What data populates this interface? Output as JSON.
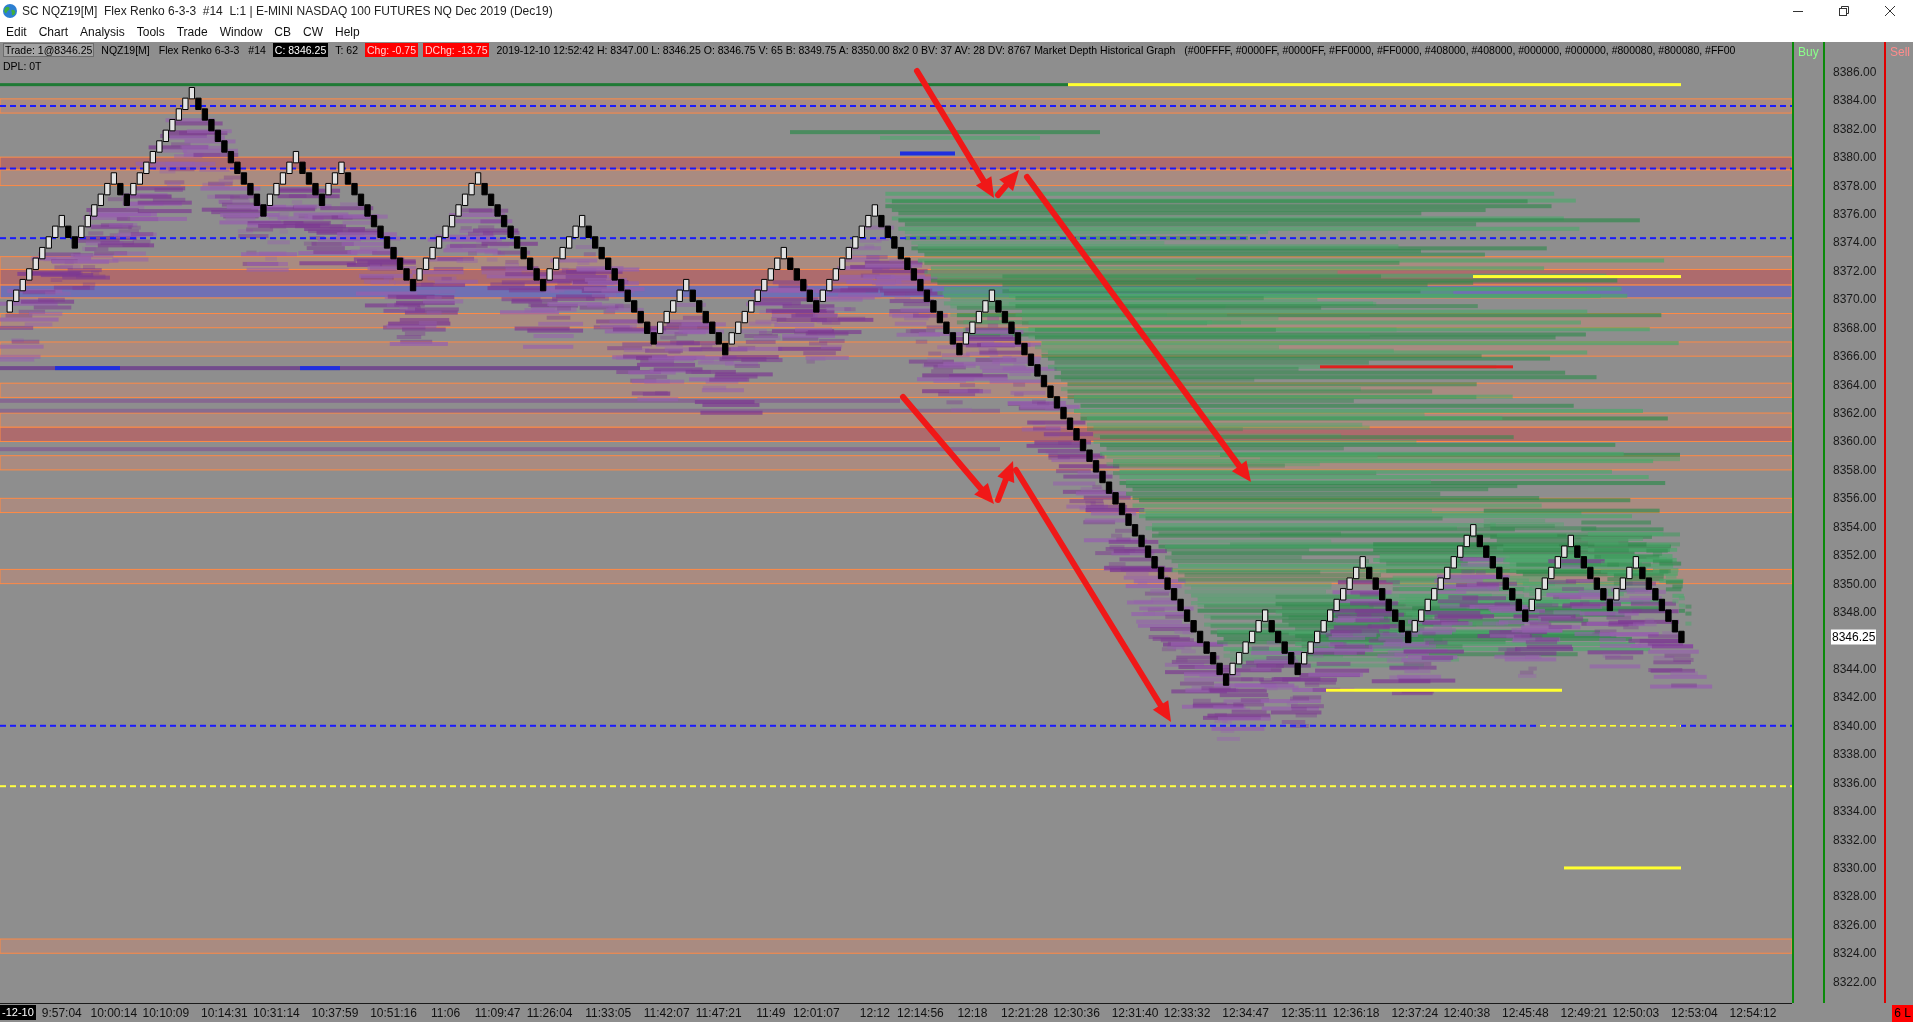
{
  "window": {
    "title": "SC NQZ19[M]  Flex Renko 6-3-3  #14  L:1 | E-MINI NASDAQ 100 FUTURES NQ Dec 2019 (Dec19)"
  },
  "menu": [
    "Edit",
    "Chart",
    "Analysis",
    "Tools",
    "Trade",
    "Window",
    "CB",
    "CW",
    "Help"
  ],
  "info_bar": {
    "items": [
      {
        "text": "Trade: 1@8346.25",
        "kind": "boxed"
      },
      {
        "text": "NQZ19[M]",
        "kind": "plain"
      },
      {
        "text": "Flex Renko 6-3-3",
        "kind": "plain"
      },
      {
        "text": "#14",
        "kind": "plain"
      },
      {
        "text": "C: 8346.25",
        "kind": "inverse"
      },
      {
        "text": "T: 62",
        "kind": "plain"
      },
      {
        "text": "Chg: -0.75",
        "kind": "alert"
      },
      {
        "text": "DChg: -13.75",
        "kind": "alert"
      },
      {
        "text": "2019-12-10 12:52:42 H: 8347.00 L: 8346.25 O: 8346.75 V: 65 B: 8349.75 A: 8350.00 8x2 0 BV: 37 AV: 28 DV: 8767 Market Depth Historical Graph",
        "kind": "plain"
      },
      {
        "text": "(#00FFFF, #0000FF, #0000FF, #FF0000, #FF0000, #408000, #408000, #000000, #000000, #800080, #800080, #FF00",
        "kind": "plain"
      }
    ],
    "second_line": "DPL: 0T"
  },
  "trade_columns": {
    "buy_label": "Buy",
    "sell_label": "Sell",
    "order_badge": "6 L"
  },
  "price_scale": {
    "last_price_label": "8346.25"
  },
  "time_axis": {
    "date_label": "-12-10"
  },
  "chart_data": {
    "type": "scatter",
    "categories": [
      null,
      null,
      null,
      null,
      null,
      null,
      null,
      null,
      "9:57:04",
      null,
      null,
      null,
      null,
      null,
      null,
      null,
      "10:00:14",
      null,
      null,
      null,
      null,
      null,
      null,
      null,
      "10:10:09",
      null,
      null,
      null,
      null,
      null,
      null,
      null,
      null,
      "10:14:31",
      null,
      null,
      null,
      null,
      null,
      null,
      null,
      "10:31:14",
      null,
      null,
      null,
      null,
      null,
      null,
      null,
      null,
      "10:37:59",
      null,
      null,
      null,
      null,
      null,
      null,
      null,
      null,
      "10:51:16",
      null,
      null,
      null,
      null,
      null,
      null,
      null,
      "11:06",
      null,
      null,
      null,
      null,
      null,
      null,
      null,
      "11:09:47",
      null,
      null,
      null,
      null,
      null,
      null,
      null,
      "11:26:04",
      null,
      null,
      null,
      null,
      null,
      null,
      null,
      null,
      "11:33:05",
      null,
      null,
      null,
      null,
      null,
      null,
      null,
      null,
      "11:42:07",
      null,
      null,
      null,
      null,
      null,
      null,
      null,
      "11:47:21",
      null,
      null,
      null,
      null,
      null,
      null,
      null,
      "11:49",
      null,
      null,
      null,
      null,
      null,
      null,
      "12:01:07",
      null,
      null,
      null,
      null,
      null,
      null,
      null,
      null,
      "12:12",
      null,
      null,
      null,
      null,
      null,
      null,
      "12:14:56",
      null,
      null,
      null,
      null,
      null,
      null,
      null,
      "12:18",
      null,
      null,
      null,
      null,
      null,
      null,
      null,
      "12:21:28",
      null,
      null,
      null,
      null,
      null,
      null,
      null,
      "12:30:36",
      null,
      null,
      null,
      null,
      null,
      null,
      null,
      null,
      "12:31:40",
      null,
      null,
      null,
      null,
      null,
      null,
      null,
      "12:33:32",
      null,
      null,
      null,
      null,
      null,
      null,
      null,
      null,
      "12:34:47",
      null,
      null,
      null,
      null,
      null,
      null,
      null,
      null,
      "12:35:11",
      null,
      null,
      null,
      null,
      null,
      null,
      null,
      "12:36:18",
      null,
      null,
      null,
      null,
      null,
      null,
      null,
      null,
      "12:37:24",
      null,
      null,
      null,
      null,
      null,
      null,
      null,
      "12:40:38",
      null,
      null,
      null,
      null,
      null,
      null,
      null,
      null,
      "12:45:48",
      null,
      null,
      null,
      null,
      null,
      null,
      null,
      null,
      "12:49:21",
      null,
      null,
      null,
      null,
      null,
      null,
      null,
      "12:50:03",
      null,
      null,
      null,
      null,
      null,
      null,
      null,
      null,
      "12:53:04",
      null,
      null,
      null,
      null,
      null,
      null,
      null,
      null,
      "12:54:12",
      null,
      null,
      null,
      null,
      null
    ],
    "ylim": [
      8320.5,
      8388.1
    ],
    "yticks": [
      {
        "value": 8386,
        "label": "8386.00"
      },
      {
        "value": 8384,
        "label": "8384.00"
      },
      {
        "value": 8382,
        "label": "8382.00"
      },
      {
        "value": 8380,
        "label": "8380.00"
      },
      {
        "value": 8378,
        "label": "8378.00"
      },
      {
        "value": 8376,
        "label": "8376.00"
      },
      {
        "value": 8374,
        "label": "8374.00"
      },
      {
        "value": 8372,
        "label": "8372.00"
      },
      {
        "value": 8370,
        "label": "8370.00"
      },
      {
        "value": 8368,
        "label": "8368.00"
      },
      {
        "value": 8366,
        "label": "8366.00"
      },
      {
        "value": 8364,
        "label": "8364.00"
      },
      {
        "value": 8362,
        "label": "8362.00"
      },
      {
        "value": 8360,
        "label": "8360.00"
      },
      {
        "value": 8358,
        "label": "8358.00"
      },
      {
        "value": 8356,
        "label": "8356.00"
      },
      {
        "value": 8354,
        "label": "8354.00"
      },
      {
        "value": 8352,
        "label": "8352.00"
      },
      {
        "value": 8350,
        "label": "8350.00"
      },
      {
        "value": 8348,
        "label": "8348.00"
      },
      {
        "value": 8344,
        "label": "8344.00"
      },
      {
        "value": 8342,
        "label": "8342.00"
      },
      {
        "value": 8340,
        "label": "8340.00"
      },
      {
        "value": 8338,
        "label": "8338.00"
      },
      {
        "value": 8336,
        "label": "8336.00"
      },
      {
        "value": 8334,
        "label": "8334.00"
      },
      {
        "value": 8332,
        "label": "8332.00"
      },
      {
        "value": 8330,
        "label": "8330.00"
      },
      {
        "value": 8328,
        "label": "8328.00"
      },
      {
        "value": 8326,
        "label": "8326.00"
      },
      {
        "value": 8324,
        "label": "8324.00"
      },
      {
        "value": 8322,
        "label": "8322.00"
      }
    ],
    "series": [
      {
        "color": "#e2e2e2",
        "values": [
          8369.5,
          8370.25,
          8371.0,
          8371.75,
          8372.5,
          8373.25,
          8374.0,
          8374.75,
          8375.5,
          null,
          null,
          8374.75,
          8375.5,
          8376.25,
          8377.0,
          8377.75,
          8378.5,
          null,
          null,
          8377.75,
          8378.5,
          8379.25,
          8380.0,
          8380.75,
          8381.5,
          8382.25,
          8383.0,
          8383.75,
          8384.5,
          null,
          null,
          null,
          null,
          null,
          null,
          null,
          null,
          null,
          null,
          null,
          8377.0,
          8377.75,
          8378.5,
          8379.25,
          8380.0,
          null,
          null,
          null,
          null,
          8377.75,
          8378.5,
          8379.25,
          null,
          null,
          null,
          null,
          null,
          null,
          null,
          null,
          null,
          null,
          null,
          8371.75,
          8372.5,
          8373.25,
          8374.0,
          8374.75,
          8375.5,
          8376.25,
          8377.0,
          8377.75,
          8378.5,
          null,
          null,
          null,
          null,
          null,
          null,
          null,
          null,
          null,
          null,
          8371.75,
          8372.5,
          8373.25,
          8374.0,
          8374.75,
          8375.5,
          null,
          null,
          null,
          null,
          null,
          null,
          null,
          null,
          null,
          null,
          null,
          8368.0,
          8368.75,
          8369.5,
          8370.25,
          8371.0,
          null,
          null,
          null,
          null,
          null,
          null,
          8367.25,
          8368.0,
          8368.75,
          8369.5,
          8370.25,
          8371.0,
          8371.75,
          8372.5,
          8373.25,
          null,
          null,
          null,
          null,
          null,
          8370.25,
          8371.0,
          8371.75,
          8372.5,
          8373.25,
          8374.0,
          8374.75,
          8375.5,
          8376.25,
          null,
          null,
          null,
          null,
          null,
          null,
          null,
          null,
          null,
          null,
          null,
          null,
          null,
          8367.25,
          8368.0,
          8368.75,
          8369.5,
          8370.25,
          null,
          null,
          null,
          null,
          null,
          null,
          null,
          null,
          null,
          null,
          null,
          null,
          null,
          null,
          null,
          null,
          null,
          null,
          null,
          null,
          null,
          null,
          null,
          null,
          null,
          null,
          null,
          null,
          null,
          null,
          null,
          null,
          null,
          null,
          null,
          null,
          8344.0,
          8344.75,
          8345.5,
          8346.25,
          8347.0,
          8347.75,
          null,
          null,
          null,
          null,
          null,
          8344.75,
          8345.5,
          8346.25,
          8347.0,
          8347.75,
          8348.5,
          8349.25,
          8350.0,
          8350.75,
          8351.5,
          null,
          null,
          null,
          null,
          null,
          null,
          null,
          8347.0,
          8347.75,
          8348.5,
          8349.25,
          8350.0,
          8350.75,
          8351.5,
          8352.25,
          8353.0,
          8353.75,
          null,
          null,
          null,
          null,
          null,
          null,
          null,
          null,
          8348.5,
          8349.25,
          8350.0,
          8350.75,
          8351.5,
          8352.25,
          8353.0,
          null,
          null,
          null,
          null,
          null,
          null,
          8349.25,
          8350.0,
          8350.75,
          8351.5,
          null,
          null,
          null,
          null,
          null,
          null,
          null,
          null,
          null,
          null,
          null,
          null,
          null,
          null,
          null,
          null,
          null,
          null,
          null,
          null,
          null,
          null,
          null
        ]
      },
      {
        "color": "#000000",
        "values": [
          null,
          null,
          null,
          null,
          null,
          null,
          null,
          null,
          null,
          8374.75,
          8374.0,
          null,
          null,
          null,
          null,
          null,
          null,
          8377.75,
          8377.0,
          null,
          null,
          null,
          null,
          null,
          null,
          null,
          null,
          null,
          null,
          8383.75,
          8383.0,
          8382.25,
          8381.5,
          8380.75,
          8380.0,
          8379.25,
          8378.5,
          8377.75,
          8377.0,
          8376.25,
          null,
          null,
          null,
          null,
          null,
          8379.25,
          8378.5,
          8377.75,
          8377.0,
          null,
          null,
          null,
          8378.5,
          8377.75,
          8377.0,
          8376.25,
          8375.5,
          8374.75,
          8374.0,
          8373.25,
          8372.5,
          8371.75,
          8371.0,
          null,
          null,
          null,
          null,
          null,
          null,
          null,
          null,
          null,
          null,
          8377.75,
          8377.0,
          8376.25,
          8375.5,
          8374.75,
          8374.0,
          8373.25,
          8372.5,
          8371.75,
          8371.0,
          null,
          null,
          null,
          null,
          null,
          null,
          8374.75,
          8374.0,
          8373.25,
          8372.5,
          8371.75,
          8371.0,
          8370.25,
          8369.5,
          8368.75,
          8368.0,
          8367.25,
          null,
          null,
          null,
          null,
          null,
          8370.25,
          8369.5,
          8368.75,
          8368.0,
          8367.25,
          8366.5,
          null,
          null,
          null,
          null,
          null,
          null,
          null,
          null,
          null,
          8372.5,
          8371.75,
          8371.0,
          8370.25,
          8369.5,
          null,
          null,
          null,
          null,
          null,
          null,
          null,
          null,
          null,
          8375.5,
          8374.75,
          8374.0,
          8373.25,
          8372.5,
          8371.75,
          8371.0,
          8370.25,
          8369.5,
          8368.75,
          8368.0,
          8367.25,
          8366.5,
          null,
          null,
          null,
          null,
          null,
          8369.5,
          8368.75,
          8368.0,
          8367.25,
          8366.5,
          8365.75,
          8365.0,
          8364.25,
          8363.5,
          8362.75,
          8362.0,
          8361.25,
          8360.5,
          8359.75,
          8359.0,
          8358.25,
          8357.5,
          8356.75,
          8356.0,
          8355.25,
          8354.5,
          8353.75,
          8353.0,
          8352.25,
          8351.5,
          8350.75,
          8350.0,
          8349.25,
          8348.5,
          8347.75,
          8347.0,
          8346.25,
          8345.5,
          8344.75,
          8344.0,
          8343.25,
          null,
          null,
          null,
          null,
          null,
          null,
          8347.0,
          8346.25,
          8345.5,
          8344.75,
          8344.0,
          null,
          null,
          null,
          null,
          null,
          null,
          null,
          null,
          null,
          null,
          8350.75,
          8350.0,
          8349.25,
          8348.5,
          8347.75,
          8347.0,
          8346.25,
          null,
          null,
          null,
          null,
          null,
          null,
          null,
          null,
          null,
          null,
          8353.0,
          8352.25,
          8351.5,
          8350.75,
          8350.0,
          8349.25,
          8348.5,
          8347.75,
          null,
          null,
          null,
          null,
          null,
          null,
          null,
          8352.25,
          8351.5,
          8350.75,
          8350.0,
          8349.25,
          8348.5,
          null,
          null,
          null,
          null,
          8350.75,
          8350.0,
          8349.25,
          8348.5,
          8347.75,
          8347.0,
          8346.25,
          null,
          null,
          null,
          null,
          null,
          null,
          null,
          null,
          null,
          null,
          null,
          null,
          null,
          null,
          null,
          null
        ]
      }
    ]
  }
}
